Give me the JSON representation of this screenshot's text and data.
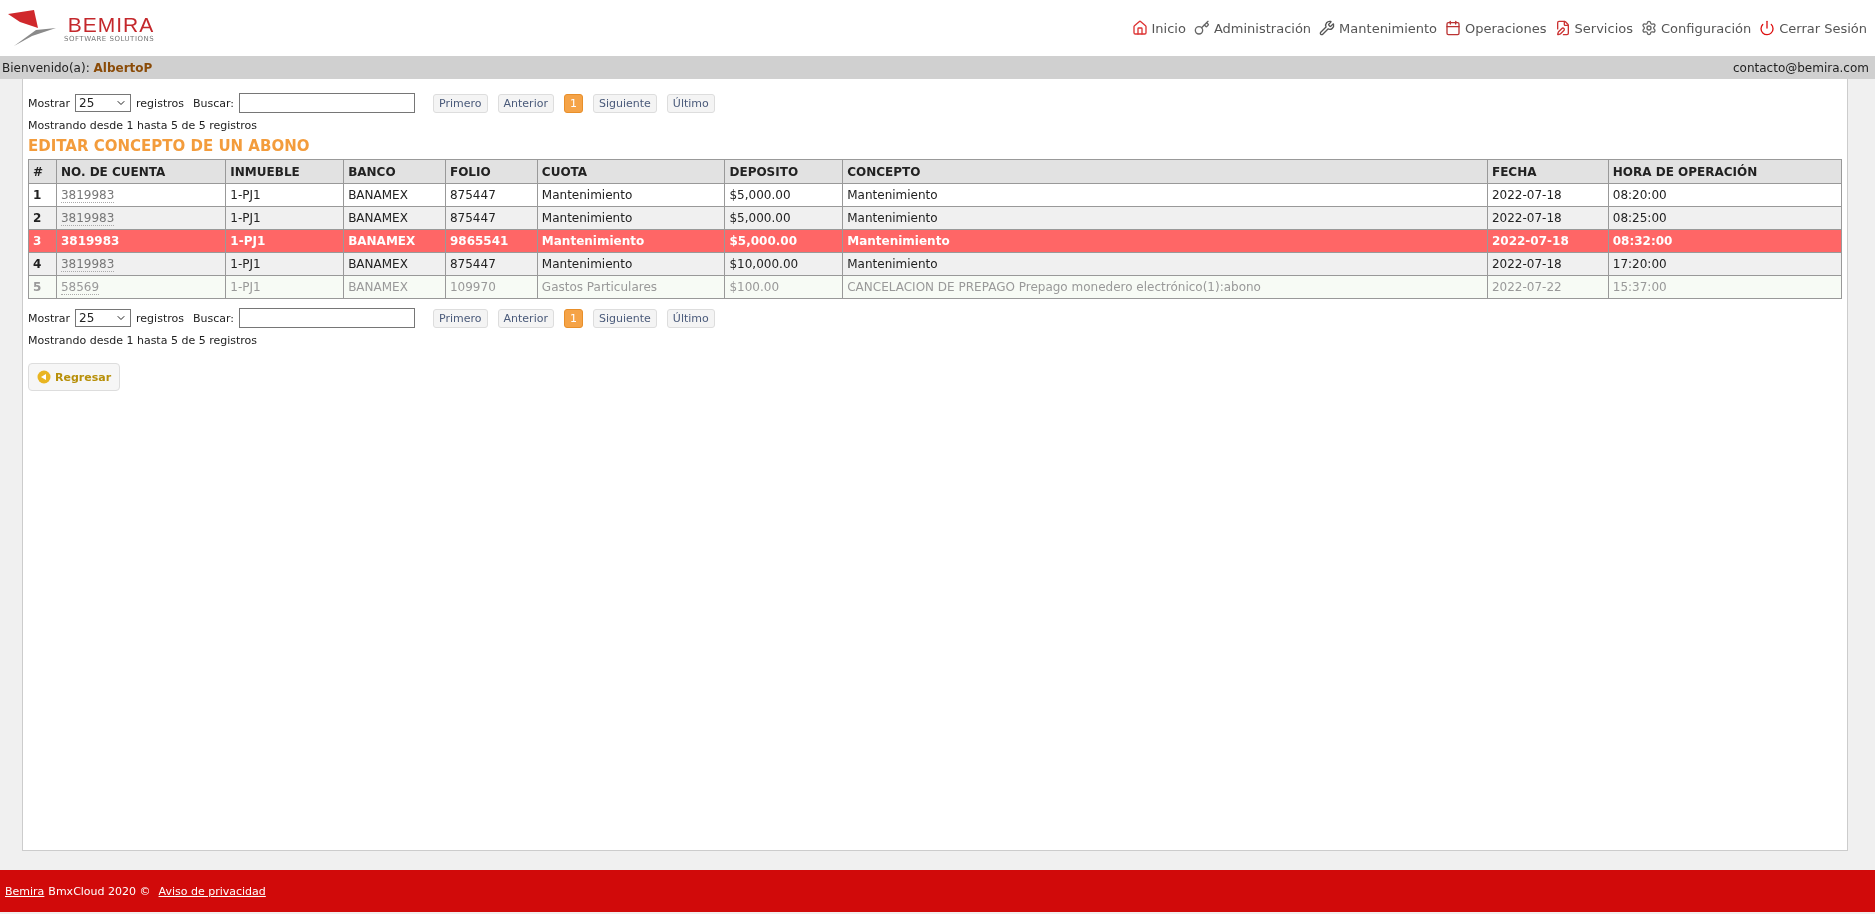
{
  "logo": {
    "name": "BEMIRA",
    "tagline": "SOFTWARE SOLUTIONS"
  },
  "nav": [
    {
      "label": "Inicio"
    },
    {
      "label": "Administración"
    },
    {
      "label": "Mantenimiento"
    },
    {
      "label": "Operaciones"
    },
    {
      "label": "Servicios"
    },
    {
      "label": "Configuración"
    },
    {
      "label": "Cerrar Sesión"
    }
  ],
  "user_bar": {
    "greeting": "Bienvenido(a):",
    "user": "AlbertoP",
    "email": "contacto@bemira.com"
  },
  "controls_top": {
    "show_label": "Mostrar",
    "page_size": "25",
    "records_label": "registros",
    "search_label": "Buscar:",
    "info": "Mostrando desde 1 hasta 5 de 5 registros"
  },
  "pager_top": [
    {
      "label": "Primero",
      "selected": false
    },
    {
      "label": "Anterior",
      "selected": false
    },
    {
      "label": "1",
      "selected": true
    },
    {
      "label": "Siguiente",
      "selected": false
    },
    {
      "label": "Último",
      "selected": false
    }
  ],
  "title": "EDITAR CONCEPTO DE UN ABONO",
  "table": {
    "columns": [
      "#",
      "NO. DE CUENTA",
      "INMUEBLE",
      "BANCO",
      "FOLIO",
      "CUOTA",
      "DEPOSITO",
      "CONCEPTO",
      "FECHA",
      "HORA DE OPERACIÓN"
    ],
    "rows": [
      {
        "selected": false,
        "faded": false,
        "cells": [
          "1",
          "3819983",
          "1-PJ1",
          "BANAMEX",
          "875447",
          "Mantenimiento",
          "$5,000.00",
          "Mantenimiento",
          "2022-07-18",
          "08:20:00"
        ]
      },
      {
        "selected": false,
        "faded": false,
        "cells": [
          "2",
          "3819983",
          "1-PJ1",
          "BANAMEX",
          "875447",
          "Mantenimiento",
          "$5,000.00",
          "Mantenimiento",
          "2022-07-18",
          "08:25:00"
        ]
      },
      {
        "selected": true,
        "faded": false,
        "cells": [
          "3",
          "3819983",
          "1-PJ1",
          "BANAMEX",
          "9865541",
          "Mantenimiento",
          "$5,000.00",
          "Mantenimiento",
          "2022-07-18",
          "08:32:00"
        ]
      },
      {
        "selected": false,
        "faded": false,
        "cells": [
          "4",
          "3819983",
          "1-PJ1",
          "BANAMEX",
          "875447",
          "Mantenimiento",
          "$10,000.00",
          "Mantenimiento",
          "2022-07-18",
          "17:20:00"
        ]
      },
      {
        "selected": false,
        "faded": true,
        "cells": [
          "5",
          "58569",
          "1-PJ1",
          "BANAMEX",
          "109970",
          "Gastos Particulares",
          "$100.00",
          "CANCELACION DE PREPAGO Prepago monedero electrónico(1):abono",
          "2022-07-22",
          "15:37:00"
        ]
      }
    ]
  },
  "controls_bottom": {
    "show_label": "Mostrar",
    "page_size": "25",
    "records_label": "registros",
    "search_label": "Buscar:",
    "info": "Mostrando desde 1 hasta 5 de 5 registros"
  },
  "pager_bottom": [
    {
      "label": "Primero",
      "selected": false
    },
    {
      "label": "Anterior",
      "selected": false
    },
    {
      "label": "1",
      "selected": true
    },
    {
      "label": "Siguiente",
      "selected": false
    },
    {
      "label": "Último",
      "selected": false
    }
  ],
  "back_button": "Regresar",
  "footer": {
    "company": "Bemira",
    "text": "BmxCloud 2020 ©",
    "privacy": "Aviso de privacidad"
  }
}
